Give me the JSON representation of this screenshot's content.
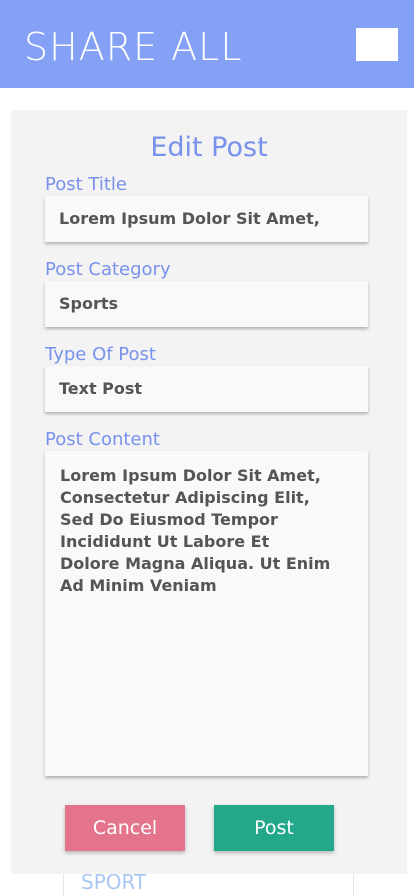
{
  "header": {
    "app_title": "SHARE ALL",
    "menu_icon": "menu-icon",
    "background_color": "#85a1f5"
  },
  "background_card": {
    "label": "SPORT"
  },
  "edit_post": {
    "title": "Edit Post",
    "fields": {
      "post_title": {
        "label": "Post Title",
        "value": "Lorem Ipsum Dolor Sit Amet,"
      },
      "post_category": {
        "label": "Post Category",
        "value": "Sports"
      },
      "type_of_post": {
        "label": "Type Of Post",
        "value": "Text Post"
      },
      "post_content": {
        "label": "Post Content",
        "value": "Lorem Ipsum Dolor Sit Amet,\nConsectetur Adipiscing Elit,\nSed Do Eiusmod Tempor\nIncididunt Ut Labore Et\nDolore Magna Aliqua. Ut Enim\nAd Minim Veniam"
      }
    },
    "buttons": {
      "cancel_label": "Cancel",
      "post_label": "Post"
    }
  },
  "colors": {
    "accent": "#7891ec",
    "cancel": "#e4738c",
    "post": "#24a88c"
  }
}
